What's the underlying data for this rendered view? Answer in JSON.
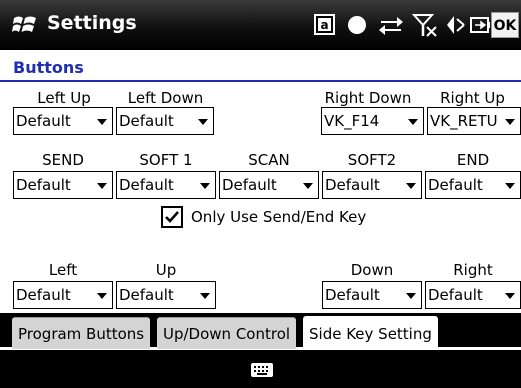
{
  "title_bar": {
    "title": "Settings",
    "ok_label": "OK",
    "icons": [
      "windows-start-icon",
      "a-square-icon",
      "circle-icon",
      "connectivity-arrows-icon",
      "no-signal-icon",
      "speaker-mute-icon",
      "battery-charging-icon"
    ]
  },
  "section_title": "Buttons",
  "row1": {
    "labels": [
      "Left Up",
      "Left Down",
      "Right Down",
      "Right Up"
    ],
    "values": [
      "Default",
      "Default",
      "VK_F14",
      "VK_RETU"
    ]
  },
  "row2": {
    "labels": [
      "SEND",
      "SOFT 1",
      "SCAN",
      "SOFT2",
      "END"
    ],
    "values": [
      "Default",
      "Default",
      "Default",
      "Default",
      "Default"
    ]
  },
  "checkbox": {
    "label": "Only Use Send/End Key",
    "checked": true
  },
  "row3": {
    "labels": [
      "Left",
      "Up",
      "Down",
      "Right"
    ],
    "values": [
      "Default",
      "Default",
      "Default",
      "Default"
    ]
  },
  "tabs": [
    {
      "label": "Program Buttons",
      "active": false
    },
    {
      "label": "Up/Down Control",
      "active": false
    },
    {
      "label": "Side Key Setting",
      "active": true
    }
  ],
  "bottom_bar": {
    "icon": "keyboard-icon"
  },
  "colors": {
    "accent": "#1e2fb0",
    "titlebar": "#000000",
    "tab_inactive": "#d4d4d4"
  }
}
